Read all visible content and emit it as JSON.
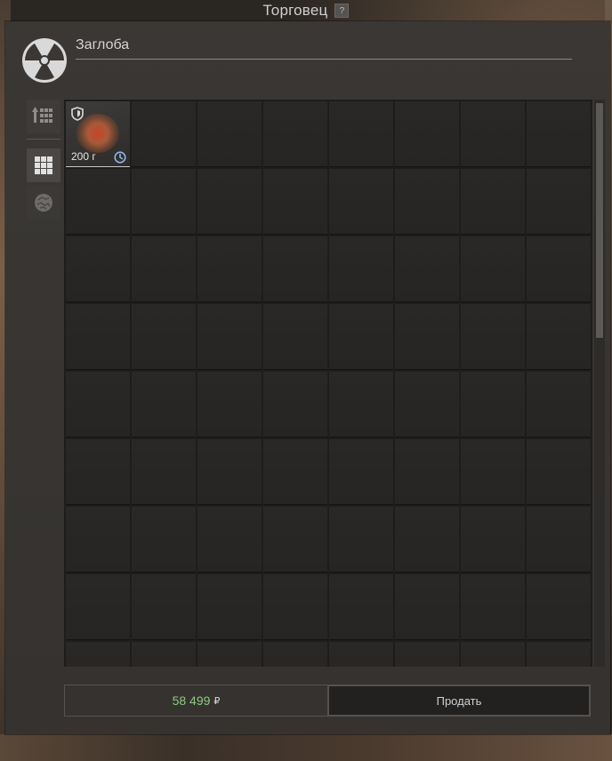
{
  "window": {
    "title": "Торговец",
    "help_label": "?"
  },
  "trader": {
    "name": "Заглоба",
    "logo_icon": "radiation-icon"
  },
  "filters": [
    {
      "name": "sort",
      "icon": "sort-grid-icon"
    },
    {
      "name": "grid-view",
      "icon": "grid-icon",
      "active": true
    },
    {
      "name": "artifacts",
      "icon": "artifact-icon"
    }
  ],
  "inventory": {
    "columns": 8,
    "rows": 9,
    "items": [
      {
        "weight": "200 г",
        "shield_icon": "shield-icon",
        "status_icon": "clock-icon",
        "image_icon": "artifact-glow-icon"
      }
    ]
  },
  "footer": {
    "total_value": "58 499",
    "currency": "₽",
    "sell_label": "Продать"
  },
  "colors": {
    "total_value": "#8ccb7e",
    "background": "#35322f"
  }
}
